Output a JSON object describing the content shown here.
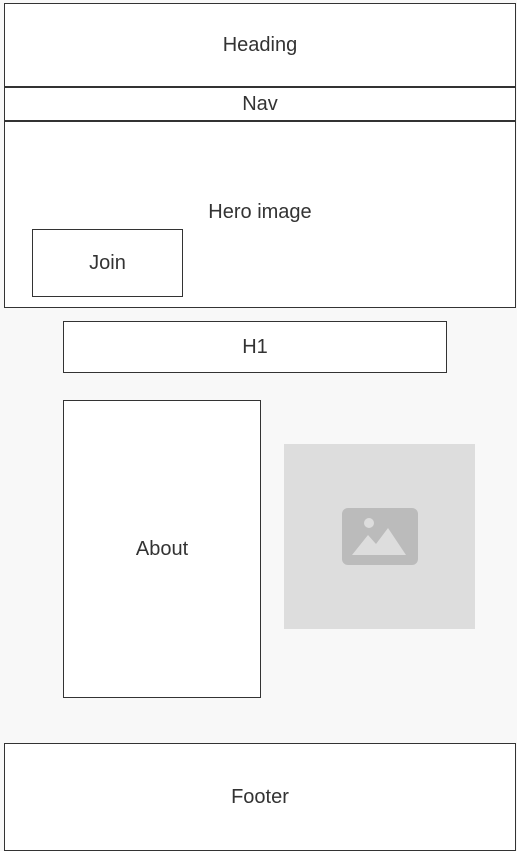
{
  "wireframe": {
    "heading": "Heading",
    "nav": "Nav",
    "hero": {
      "label": "Hero image",
      "join_button": "Join"
    },
    "h1": "H1",
    "about": "About",
    "image_placeholder_icon": "image-icon",
    "footer": "Footer",
    "colors": {
      "stroke": "#333333",
      "placeholder_bg": "#dddddd",
      "placeholder_icon": "#bbbbbb"
    }
  }
}
